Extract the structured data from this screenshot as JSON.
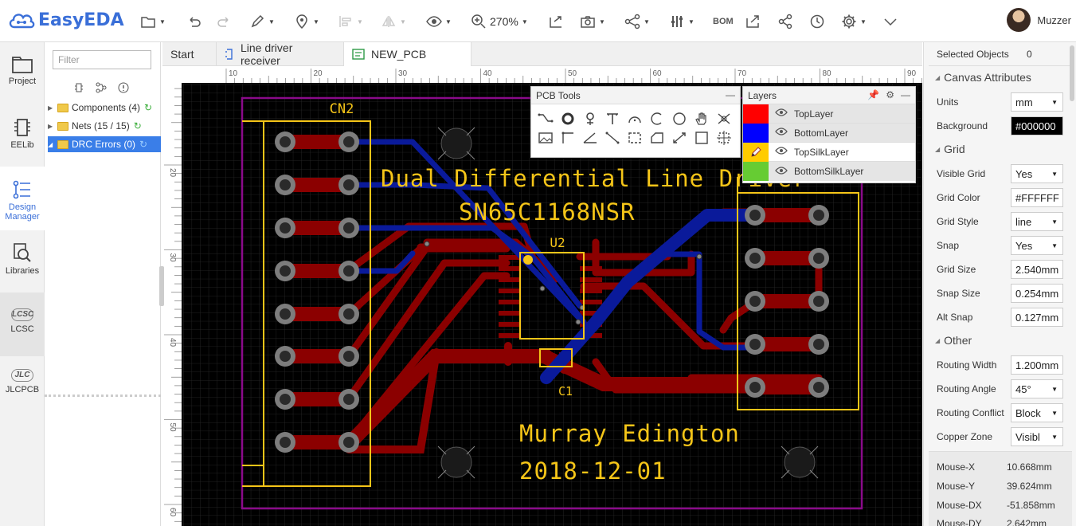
{
  "app": {
    "logo_text": "EasyEDA",
    "brand_color": "#3a6fd8"
  },
  "toolbar": {
    "zoom": "270%",
    "bom_label": "BOM",
    "user_name": "Muzzer"
  },
  "rail": {
    "project": "Project",
    "eelib": "EELib",
    "design_manager_1": "Design",
    "design_manager_2": "Manager",
    "libraries": "Libraries",
    "lcsc": "LCSC",
    "lcsc_logo": "LCSC",
    "jlcpcb": "JLCPCB",
    "jlcpcb_logo": "JLC"
  },
  "tree": {
    "filter_placeholder": "Filter",
    "items": [
      {
        "label": "Components (4)"
      },
      {
        "label": "Nets (15 / 15)"
      },
      {
        "label": "DRC Errors (0)"
      }
    ]
  },
  "tabs": [
    {
      "label": "Start"
    },
    {
      "label": "Line driver receiver"
    },
    {
      "label": "NEW_PCB"
    }
  ],
  "ruler": {
    "top": [
      "10",
      "20",
      "30",
      "40",
      "50",
      "60",
      "70",
      "80",
      "90"
    ],
    "left": [
      "20",
      "30",
      "40",
      "50",
      "60"
    ]
  },
  "board": {
    "title_line1": "Dual Differential Line Driver",
    "title_line2": "SN65C1168NSR",
    "author": "Murray Edington",
    "date": "2018-12-01",
    "ref_cn2": "CN2",
    "ref_u2": "U2",
    "ref_c1": "C1",
    "colors": {
      "top": "#8b0000",
      "bottom": "#0a1a9a",
      "silk": "#f5c518",
      "outline": "#8a0a8a",
      "background": "#000000"
    }
  },
  "pcb_tools": {
    "title": "PCB Tools"
  },
  "layers": {
    "title": "Layers",
    "items": [
      {
        "name": "TopLayer",
        "color": "#ff0000"
      },
      {
        "name": "BottomLayer",
        "color": "#0000ff"
      },
      {
        "name": "TopSilkLayer",
        "color": "#ffcc00"
      },
      {
        "name": "BottomSilkLayer",
        "color": "#66cc33"
      }
    ]
  },
  "props": {
    "selected_label": "Selected Objects",
    "selected_count": "0",
    "canvas_section": "Canvas Attributes",
    "units_label": "Units",
    "units_value": "mm",
    "background_label": "Background",
    "background_value": "#000000",
    "grid_section": "Grid",
    "visible_grid_label": "Visible Grid",
    "visible_grid_value": "Yes",
    "grid_color_label": "Grid Color",
    "grid_color_value": "#FFFFFF",
    "grid_style_label": "Grid Style",
    "grid_style_value": "line",
    "snap_label": "Snap",
    "snap_value": "Yes",
    "grid_size_label": "Grid Size",
    "grid_size_value": "2.540mm",
    "snap_size_label": "Snap Size",
    "snap_size_value": "0.254mm",
    "alt_snap_label": "Alt Snap",
    "alt_snap_value": "0.127mm",
    "other_section": "Other",
    "routing_width_label": "Routing Width",
    "routing_width_value": "1.200mm",
    "routing_angle_label": "Routing Angle",
    "routing_angle_value": "45°",
    "routing_conflict_label": "Routing Conflict",
    "routing_conflict_value": "Block",
    "copper_zone_label": "Copper Zone",
    "copper_zone_value": "Visibl",
    "mouse_x_label": "Mouse-X",
    "mouse_x_value": "10.668mm",
    "mouse_y_label": "Mouse-Y",
    "mouse_y_value": "39.624mm",
    "mouse_dx_label": "Mouse-DX",
    "mouse_dx_value": "-51.858mm",
    "mouse_dy_label": "Mouse-DY",
    "mouse_dy_value": "2.642mm"
  }
}
